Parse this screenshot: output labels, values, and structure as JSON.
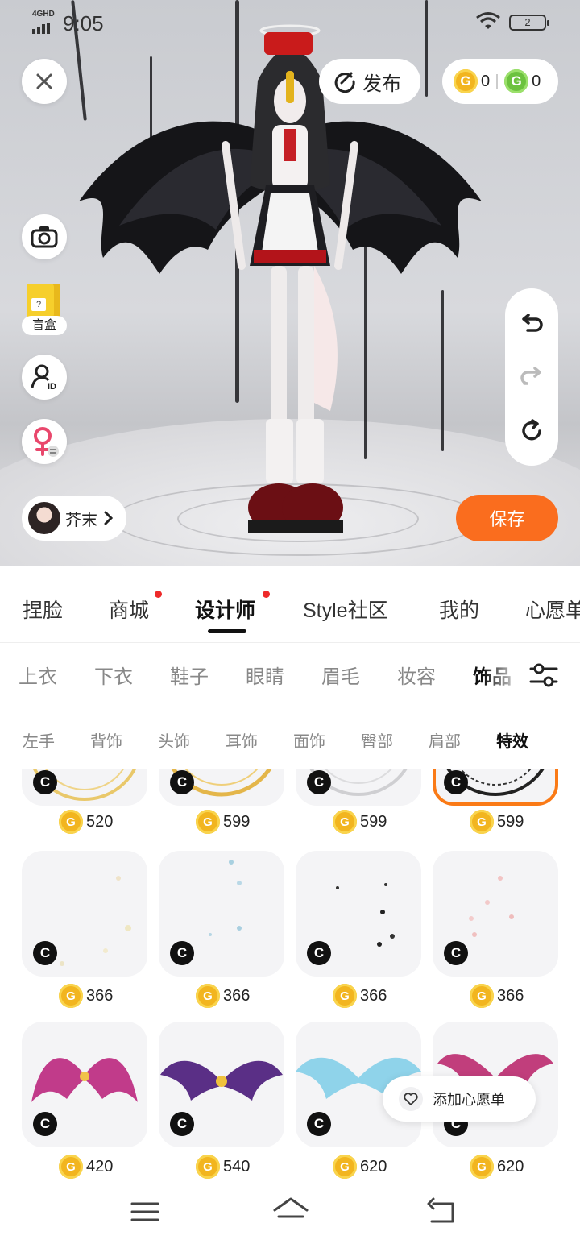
{
  "status_bar": {
    "network": "4GHD",
    "time": "9:05",
    "battery": "2"
  },
  "top_bar": {
    "publish_label": "发布",
    "gold_coins": "0",
    "green_coins": "0"
  },
  "side_tools": {
    "blind_box_label": "盲盒"
  },
  "user": {
    "name": "芥末"
  },
  "save_label": "保存",
  "main_tabs": [
    {
      "label": "捏脸"
    },
    {
      "label": "商城"
    },
    {
      "label": "设计师"
    },
    {
      "label": "Style社区"
    },
    {
      "label": "我的"
    },
    {
      "label": "心愿单"
    }
  ],
  "category_tabs": [
    {
      "label": "上衣"
    },
    {
      "label": "下衣"
    },
    {
      "label": "鞋子"
    },
    {
      "label": "眼睛"
    },
    {
      "label": "眉毛"
    },
    {
      "label": "妆容"
    },
    {
      "label": "饰品"
    }
  ],
  "sub_tabs": [
    {
      "label": "左手"
    },
    {
      "label": "背饰"
    },
    {
      "label": "头饰"
    },
    {
      "label": "耳饰"
    },
    {
      "label": "面饰"
    },
    {
      "label": "臀部"
    },
    {
      "label": "肩部"
    },
    {
      "label": "特效"
    }
  ],
  "items": [
    {
      "price": "520"
    },
    {
      "price": "599"
    },
    {
      "price": "599"
    },
    {
      "price": "599"
    },
    {
      "price": "366"
    },
    {
      "price": "366"
    },
    {
      "price": "366"
    },
    {
      "price": "366"
    },
    {
      "price": "420"
    },
    {
      "price": "540"
    },
    {
      "price": "620"
    },
    {
      "price": "620"
    }
  ],
  "badge_letter": "C",
  "coin_letter": "G",
  "wishlist_label": "添加心愿单",
  "colors": {
    "accent": "#fa6d1e",
    "selected_border": "#fa7a16",
    "red_dot": "#ee2a2a",
    "gold_coin": "#f2b51f",
    "green_coin": "#6cc23f"
  }
}
